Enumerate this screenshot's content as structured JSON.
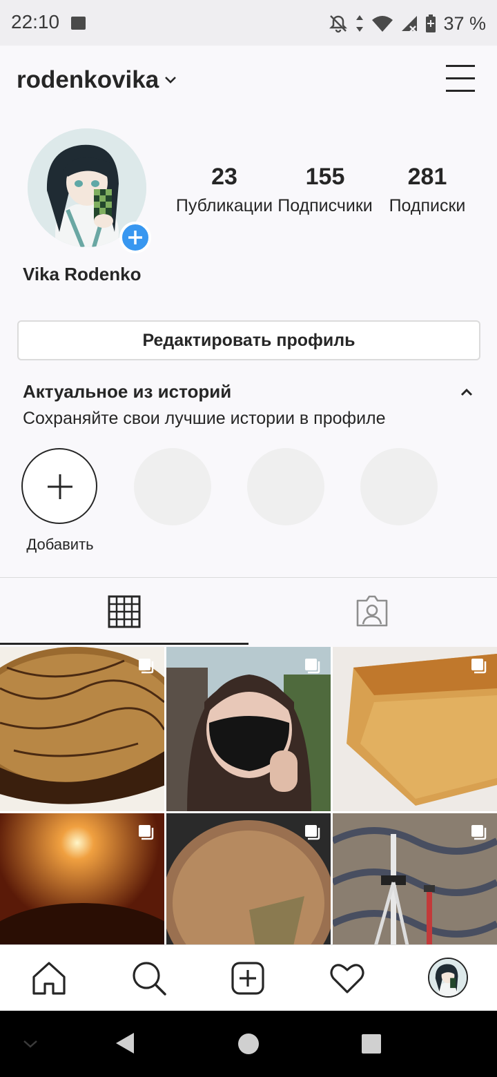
{
  "status_bar": {
    "time": "22:10",
    "battery": "37 %"
  },
  "header": {
    "username": "rodenkovika"
  },
  "profile": {
    "full_name": "Vika Rodenko",
    "stats": [
      {
        "value": "23",
        "label": "Публикации"
      },
      {
        "value": "155",
        "label": "Подписчики"
      },
      {
        "value": "281",
        "label": "Подписки"
      }
    ],
    "edit_button": "Редактировать профиль"
  },
  "highlights": {
    "title": "Актуальное из историй",
    "subtitle": "Сохраняйте свои лучшие истории в профиле",
    "add_label": "Добавить"
  },
  "tabs": [
    {
      "name": "grid-tab",
      "icon": "grid-icon",
      "active": true
    },
    {
      "name": "tagged-tab",
      "icon": "tagged-person-icon",
      "active": false
    }
  ],
  "posts": [
    {
      "subject": "chocolate cake",
      "multi": true
    },
    {
      "subject": "girl in black mask",
      "multi": true
    },
    {
      "subject": "honey cake slice",
      "multi": true
    },
    {
      "subject": "candle light",
      "multi": true
    },
    {
      "subject": "crumb cake in pan",
      "multi": true
    },
    {
      "subject": "tripod on carpet",
      "multi": true
    }
  ],
  "bottom_nav": [
    "home-icon",
    "search-icon",
    "new-post-icon",
    "activity-heart-icon",
    "profile-avatar"
  ],
  "colors": {
    "accent": "#3897f0",
    "text": "#262626",
    "border": "#dbdbdb"
  }
}
